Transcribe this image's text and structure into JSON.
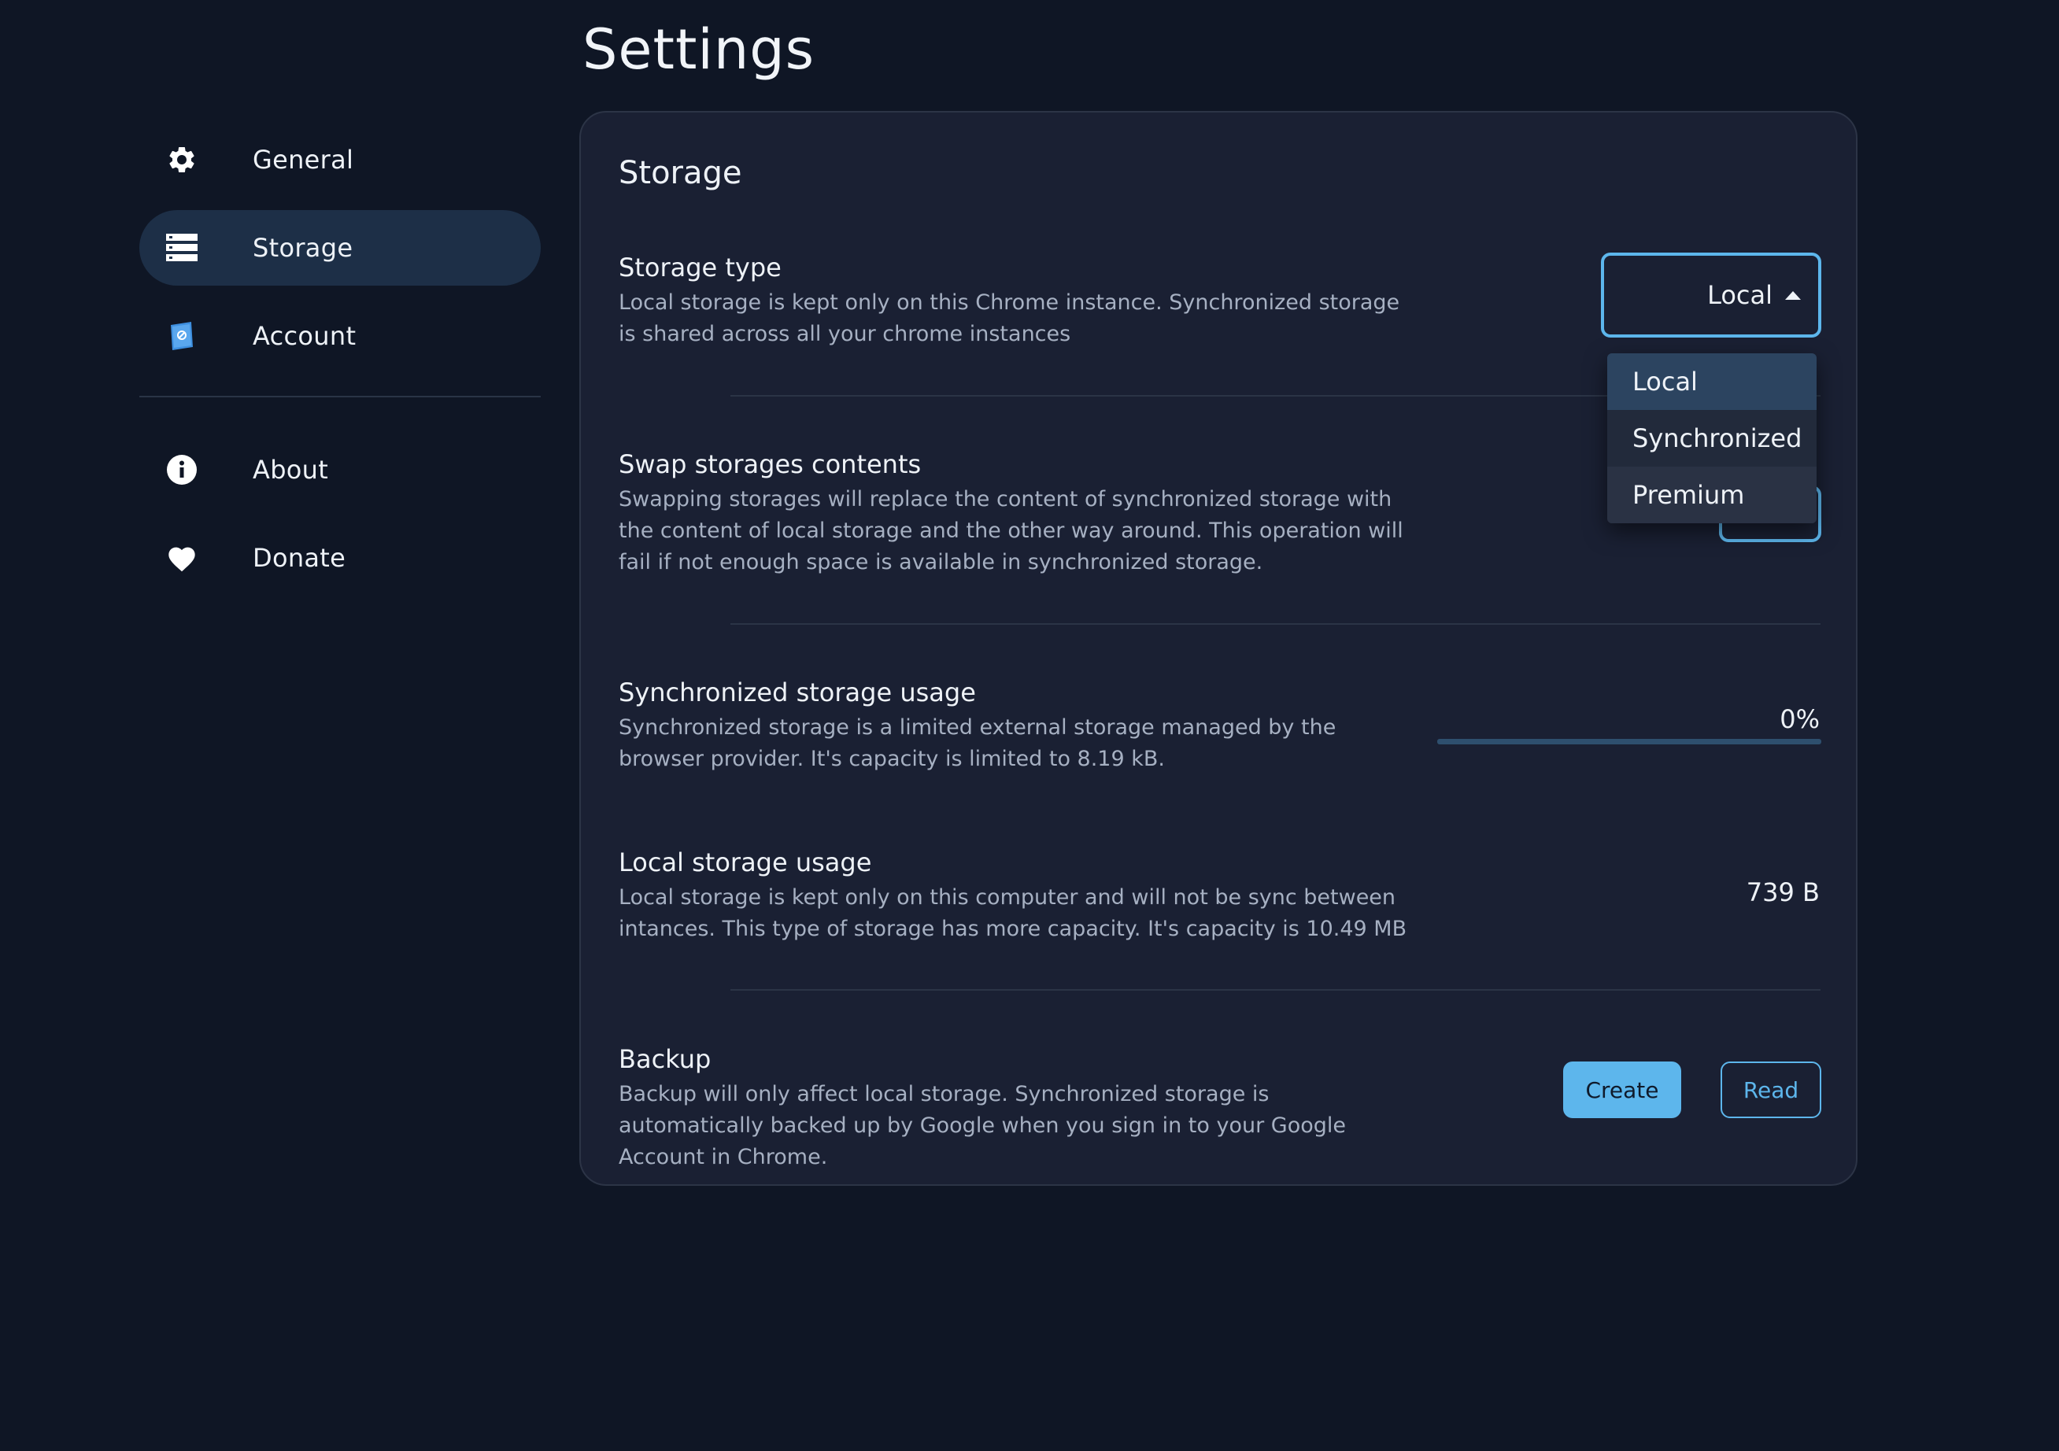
{
  "page": {
    "title": "Settings"
  },
  "sidebar": {
    "items": [
      {
        "label": "General",
        "icon": "gear-icon"
      },
      {
        "label": "Storage",
        "icon": "storage-icon",
        "active": true
      },
      {
        "label": "Account",
        "icon": "account-icon"
      },
      {
        "label": "About",
        "icon": "info-icon"
      },
      {
        "label": "Donate",
        "icon": "heart-icon"
      }
    ]
  },
  "card": {
    "title": "Storage",
    "storage_type": {
      "title": "Storage type",
      "description": "Local storage is kept only on this Chrome instance. Synchronized storage is shared across all your chrome instances",
      "selected": "Local",
      "options": [
        "Local",
        "Synchronized",
        "Premium"
      ]
    },
    "swap": {
      "title": "Swap storages contents",
      "description": "Swapping storages will replace the content of synchronized storage with the content of local storage and the other way around. This operation will fail if not enough space is available in synchronized storage."
    },
    "sync_usage": {
      "title": "Synchronized storage usage",
      "description": "Synchronized storage is a limited external storage managed by the browser provider. It's capacity is limited to 8.19 kB.",
      "value": "0%",
      "percent": 0
    },
    "local_usage": {
      "title": "Local storage usage",
      "description": "Local storage is kept only on this computer and will not be sync between intances. This type of storage has more capacity. It's capacity is 10.49 MB",
      "value": "739 B"
    },
    "backup": {
      "title": "Backup",
      "description": "Backup will only affect local storage. Synchronized storage is automatically backed up by Google when you sign in to your Google Account in Chrome.",
      "create_label": "Create",
      "read_label": "Read"
    }
  },
  "colors": {
    "background": "#0f1625",
    "card": "#1a2033",
    "accent": "#5db6ec",
    "active_nav": "#1d2f47"
  }
}
